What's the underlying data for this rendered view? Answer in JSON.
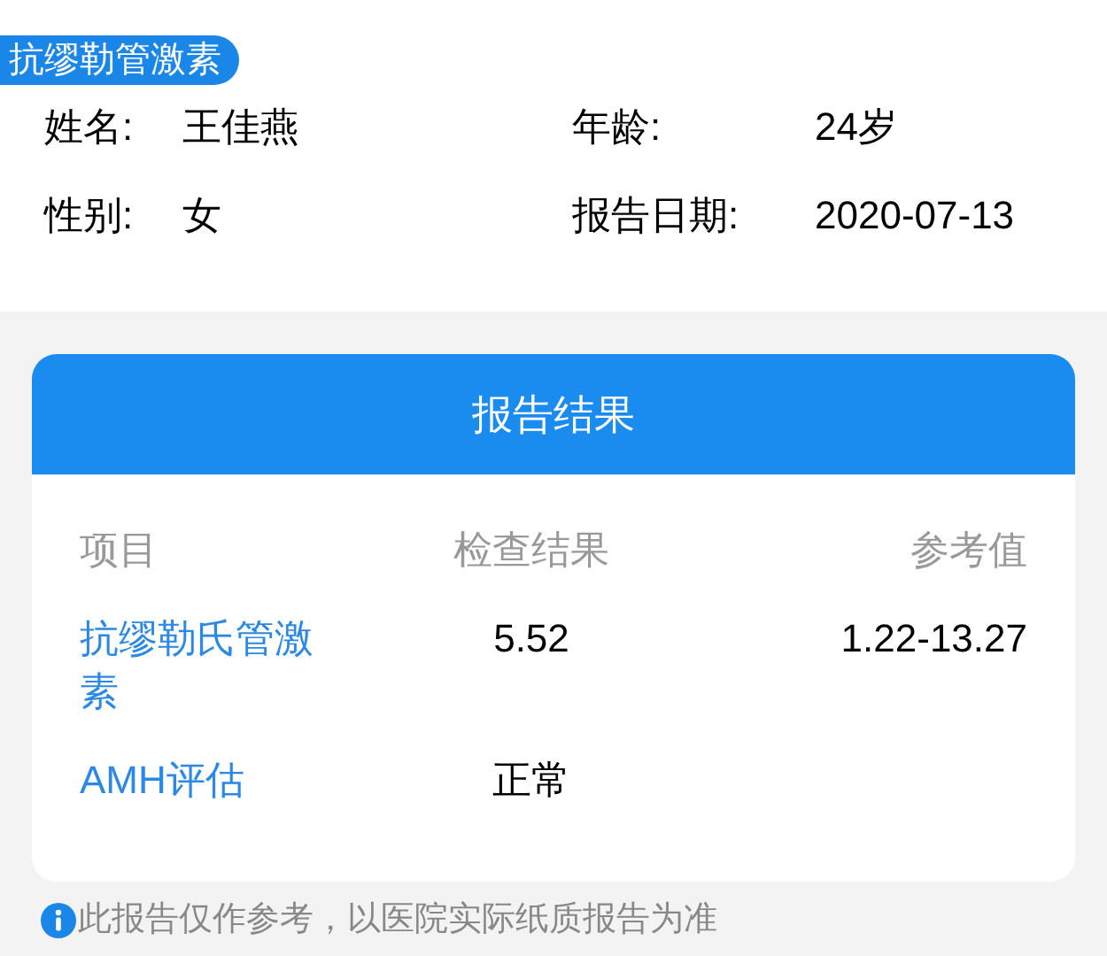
{
  "tag": "抗缪勒管激素",
  "patient": [
    {
      "label": "姓名:",
      "value": "王佳燕"
    },
    {
      "label": "年龄:",
      "value": "24岁"
    },
    {
      "label": "性别:",
      "value": "女"
    },
    {
      "label": "报告日期:",
      "value": "2020-07-13"
    }
  ],
  "card": {
    "title": "报告结果",
    "columns": [
      "项目",
      "检查结果",
      "参考值"
    ],
    "rows": [
      {
        "item": "抗缪勒氏管激素",
        "result": "5.52",
        "reference": "1.22-13.27"
      },
      {
        "item": "AMH评估",
        "result": "正常"
      }
    ]
  },
  "note": "此报告仅作参考，以医院实际纸质报告为准"
}
